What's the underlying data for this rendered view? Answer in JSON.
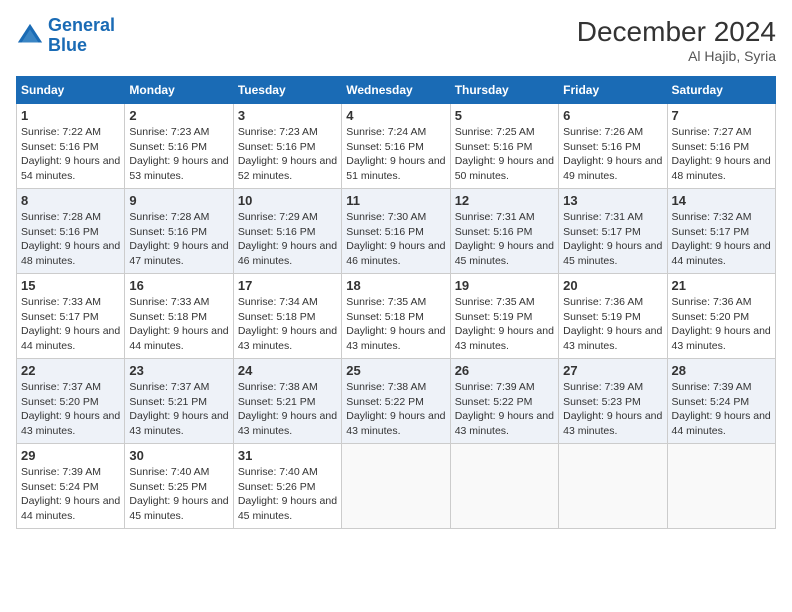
{
  "header": {
    "logo_line1": "General",
    "logo_line2": "Blue",
    "month_year": "December 2024",
    "location": "Al Hajib, Syria"
  },
  "weekdays": [
    "Sunday",
    "Monday",
    "Tuesday",
    "Wednesday",
    "Thursday",
    "Friday",
    "Saturday"
  ],
  "weeks": [
    [
      {
        "day": "1",
        "sunrise": "7:22 AM",
        "sunset": "5:16 PM",
        "daylight": "9 hours and 54 minutes."
      },
      {
        "day": "2",
        "sunrise": "7:23 AM",
        "sunset": "5:16 PM",
        "daylight": "9 hours and 53 minutes."
      },
      {
        "day": "3",
        "sunrise": "7:23 AM",
        "sunset": "5:16 PM",
        "daylight": "9 hours and 52 minutes."
      },
      {
        "day": "4",
        "sunrise": "7:24 AM",
        "sunset": "5:16 PM",
        "daylight": "9 hours and 51 minutes."
      },
      {
        "day": "5",
        "sunrise": "7:25 AM",
        "sunset": "5:16 PM",
        "daylight": "9 hours and 50 minutes."
      },
      {
        "day": "6",
        "sunrise": "7:26 AM",
        "sunset": "5:16 PM",
        "daylight": "9 hours and 49 minutes."
      },
      {
        "day": "7",
        "sunrise": "7:27 AM",
        "sunset": "5:16 PM",
        "daylight": "9 hours and 48 minutes."
      }
    ],
    [
      {
        "day": "8",
        "sunrise": "7:28 AM",
        "sunset": "5:16 PM",
        "daylight": "9 hours and 48 minutes."
      },
      {
        "day": "9",
        "sunrise": "7:28 AM",
        "sunset": "5:16 PM",
        "daylight": "9 hours and 47 minutes."
      },
      {
        "day": "10",
        "sunrise": "7:29 AM",
        "sunset": "5:16 PM",
        "daylight": "9 hours and 46 minutes."
      },
      {
        "day": "11",
        "sunrise": "7:30 AM",
        "sunset": "5:16 PM",
        "daylight": "9 hours and 46 minutes."
      },
      {
        "day": "12",
        "sunrise": "7:31 AM",
        "sunset": "5:16 PM",
        "daylight": "9 hours and 45 minutes."
      },
      {
        "day": "13",
        "sunrise": "7:31 AM",
        "sunset": "5:17 PM",
        "daylight": "9 hours and 45 minutes."
      },
      {
        "day": "14",
        "sunrise": "7:32 AM",
        "sunset": "5:17 PM",
        "daylight": "9 hours and 44 minutes."
      }
    ],
    [
      {
        "day": "15",
        "sunrise": "7:33 AM",
        "sunset": "5:17 PM",
        "daylight": "9 hours and 44 minutes."
      },
      {
        "day": "16",
        "sunrise": "7:33 AM",
        "sunset": "5:18 PM",
        "daylight": "9 hours and 44 minutes."
      },
      {
        "day": "17",
        "sunrise": "7:34 AM",
        "sunset": "5:18 PM",
        "daylight": "9 hours and 43 minutes."
      },
      {
        "day": "18",
        "sunrise": "7:35 AM",
        "sunset": "5:18 PM",
        "daylight": "9 hours and 43 minutes."
      },
      {
        "day": "19",
        "sunrise": "7:35 AM",
        "sunset": "5:19 PM",
        "daylight": "9 hours and 43 minutes."
      },
      {
        "day": "20",
        "sunrise": "7:36 AM",
        "sunset": "5:19 PM",
        "daylight": "9 hours and 43 minutes."
      },
      {
        "day": "21",
        "sunrise": "7:36 AM",
        "sunset": "5:20 PM",
        "daylight": "9 hours and 43 minutes."
      }
    ],
    [
      {
        "day": "22",
        "sunrise": "7:37 AM",
        "sunset": "5:20 PM",
        "daylight": "9 hours and 43 minutes."
      },
      {
        "day": "23",
        "sunrise": "7:37 AM",
        "sunset": "5:21 PM",
        "daylight": "9 hours and 43 minutes."
      },
      {
        "day": "24",
        "sunrise": "7:38 AM",
        "sunset": "5:21 PM",
        "daylight": "9 hours and 43 minutes."
      },
      {
        "day": "25",
        "sunrise": "7:38 AM",
        "sunset": "5:22 PM",
        "daylight": "9 hours and 43 minutes."
      },
      {
        "day": "26",
        "sunrise": "7:39 AM",
        "sunset": "5:22 PM",
        "daylight": "9 hours and 43 minutes."
      },
      {
        "day": "27",
        "sunrise": "7:39 AM",
        "sunset": "5:23 PM",
        "daylight": "9 hours and 43 minutes."
      },
      {
        "day": "28",
        "sunrise": "7:39 AM",
        "sunset": "5:24 PM",
        "daylight": "9 hours and 44 minutes."
      }
    ],
    [
      {
        "day": "29",
        "sunrise": "7:39 AM",
        "sunset": "5:24 PM",
        "daylight": "9 hours and 44 minutes."
      },
      {
        "day": "30",
        "sunrise": "7:40 AM",
        "sunset": "5:25 PM",
        "daylight": "9 hours and 45 minutes."
      },
      {
        "day": "31",
        "sunrise": "7:40 AM",
        "sunset": "5:26 PM",
        "daylight": "9 hours and 45 minutes."
      },
      null,
      null,
      null,
      null
    ]
  ]
}
